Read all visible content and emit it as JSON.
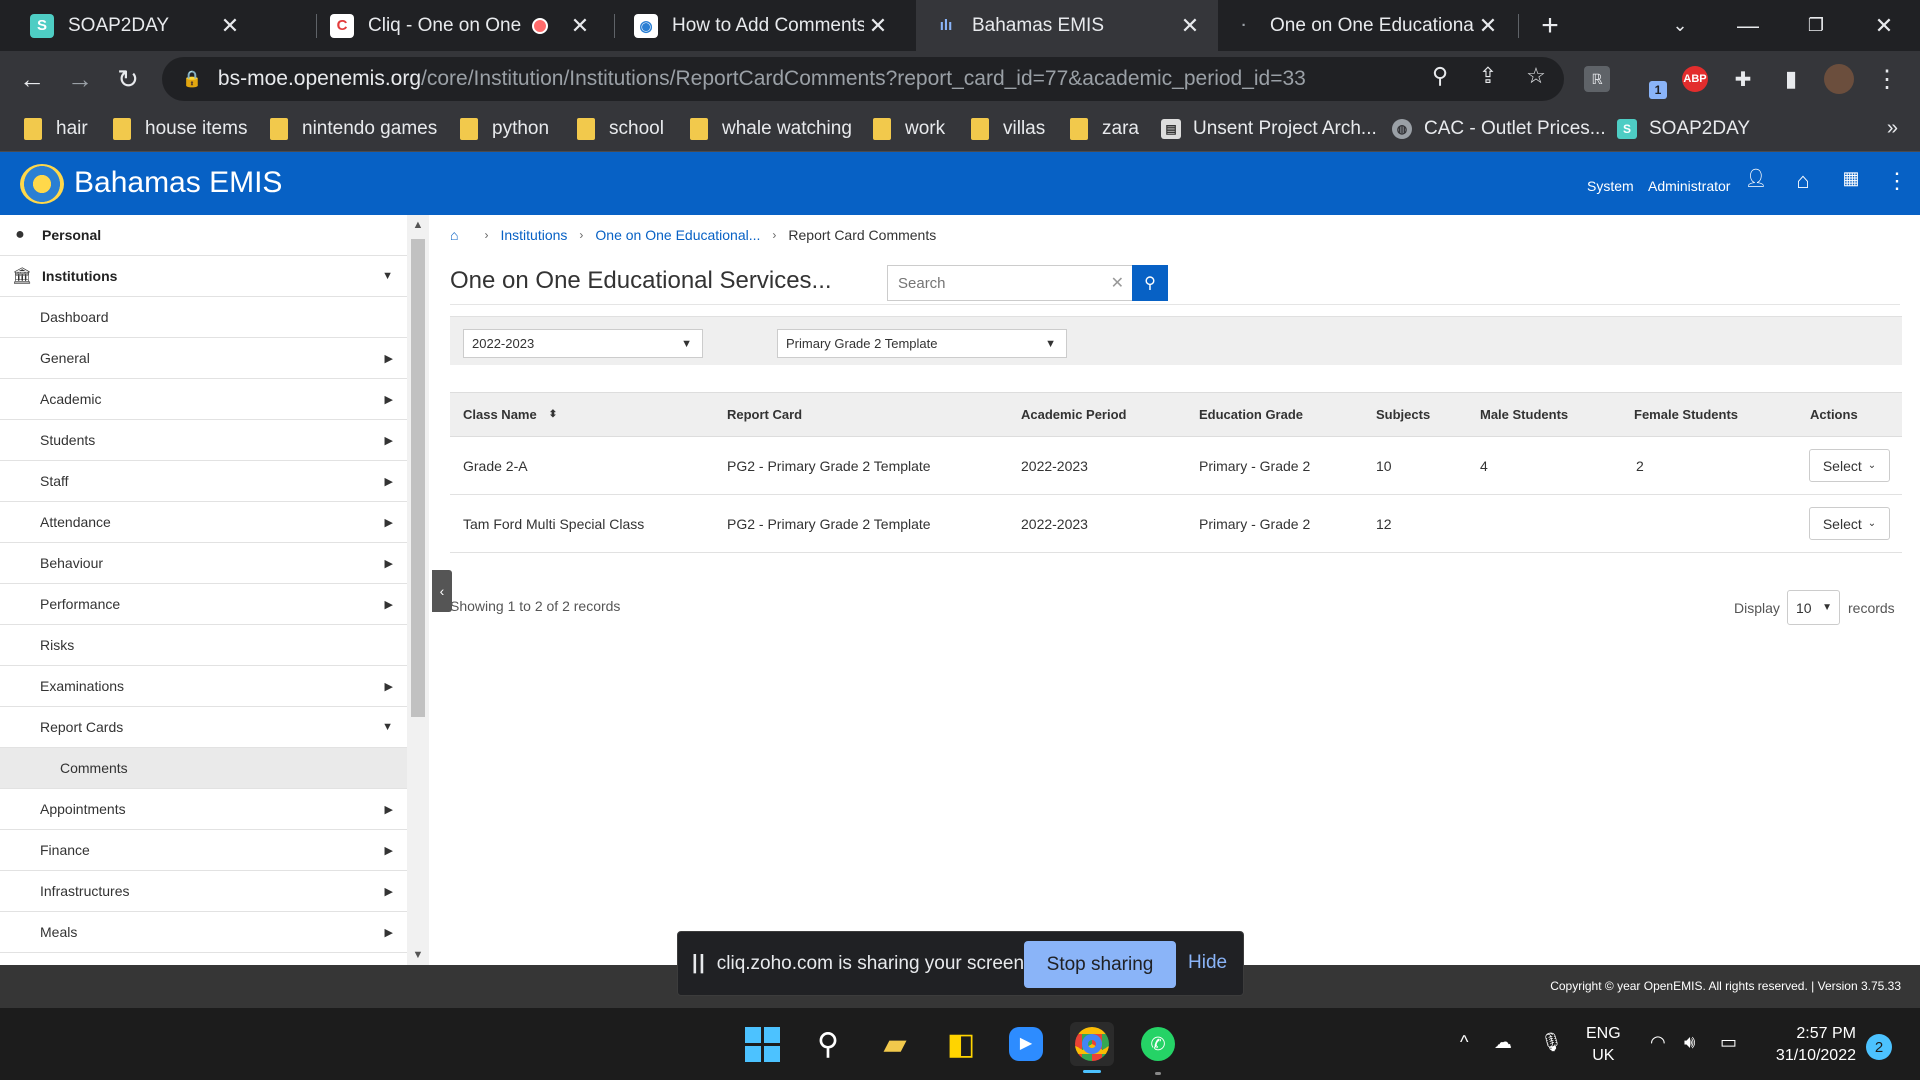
{
  "browser": {
    "tabs": [
      {
        "title": "SOAP2DAY",
        "icon": "soap2day-favicon",
        "color": "#4ecdc4",
        "glyph": "S"
      },
      {
        "title": "Cliq - One on One",
        "icon": "cliq-favicon",
        "color": "#ffffff",
        "glyph": "C"
      },
      {
        "title": "How to Add Comments T",
        "icon": "emis-favicon",
        "color": "#ffffff",
        "glyph": "◉"
      },
      {
        "title": "Bahamas EMIS",
        "icon": "emis-chart-favicon",
        "color": "#35363a",
        "glyph": "ılı"
      },
      {
        "title": "One on One Educational S",
        "icon": "loading-favicon",
        "color": "#202124",
        "glyph": "·"
      }
    ],
    "new_tab": "+",
    "url_host": "bs-moe.openemis.org",
    "url_path": "/core/Institution/Institutions/ReportCardComments?report_card_id=77&academic_period_id=33",
    "extension_badge": "ABP",
    "extension_count": "1",
    "bookmarks": [
      {
        "label": "hair",
        "type": "folder"
      },
      {
        "label": "house items",
        "type": "folder"
      },
      {
        "label": "nintendo games",
        "type": "folder"
      },
      {
        "label": "python",
        "type": "folder"
      },
      {
        "label": "school",
        "type": "folder"
      },
      {
        "label": "whale watching",
        "type": "folder"
      },
      {
        "label": "work",
        "type": "folder"
      },
      {
        "label": "villas",
        "type": "folder"
      },
      {
        "label": "zara",
        "type": "folder"
      },
      {
        "label": "Unsent Project Arch...",
        "type": "site"
      },
      {
        "label": "CAC - Outlet Prices...",
        "type": "site"
      },
      {
        "label": "SOAP2DAY",
        "type": "site"
      }
    ],
    "bookmarks_more": "»"
  },
  "app": {
    "title": "Bahamas EMIS",
    "user_label": "System",
    "user_name": "Administrator",
    "brand_color": "#0761c5"
  },
  "sidebar": {
    "items": [
      {
        "label": "Personal",
        "level": "top",
        "icon": "person-icon",
        "arrow": ""
      },
      {
        "label": "Institutions",
        "level": "top",
        "icon": "institution-icon",
        "arrow": "▼"
      },
      {
        "label": "Dashboard",
        "level": "item",
        "arrow": ""
      },
      {
        "label": "General",
        "level": "item",
        "arrow": "▶"
      },
      {
        "label": "Academic",
        "level": "item",
        "arrow": "▶"
      },
      {
        "label": "Students",
        "level": "item",
        "arrow": "▶"
      },
      {
        "label": "Staff",
        "level": "item",
        "arrow": "▶"
      },
      {
        "label": "Attendance",
        "level": "item",
        "arrow": "▶"
      },
      {
        "label": "Behaviour",
        "level": "item",
        "arrow": "▶"
      },
      {
        "label": "Performance",
        "level": "item",
        "arrow": "▶"
      },
      {
        "label": "Risks",
        "level": "item",
        "arrow": ""
      },
      {
        "label": "Examinations",
        "level": "item",
        "arrow": "▶"
      },
      {
        "label": "Report Cards",
        "level": "item",
        "arrow": "▼"
      },
      {
        "label": "Comments",
        "level": "sub",
        "arrow": ""
      },
      {
        "label": "Appointments",
        "level": "item",
        "arrow": "▶"
      },
      {
        "label": "Finance",
        "level": "item",
        "arrow": "▶"
      },
      {
        "label": "Infrastructures",
        "level": "item",
        "arrow": "▶"
      },
      {
        "label": "Meals",
        "level": "item",
        "arrow": "▶"
      }
    ]
  },
  "breadcrumb": {
    "items": [
      "Institutions",
      "One on One Educational...",
      "Report Card Comments"
    ]
  },
  "page": {
    "title": "One on One Educational Services...",
    "search_placeholder": "Search"
  },
  "filters": {
    "academic_period": "2022-2023",
    "template": "Primary Grade 2 Template"
  },
  "table": {
    "headers": [
      "Class Name",
      "Report Card",
      "Academic Period",
      "Education Grade",
      "Subjects",
      "Male Students",
      "Female Students",
      "Actions"
    ],
    "rows": [
      {
        "class_name": "Grade 2-A",
        "report_card": "PG2 - Primary Grade 2 Template",
        "academic_period": "2022-2023",
        "education_grade": "Primary - Grade 2",
        "subjects": "10",
        "male": "4",
        "female": "2",
        "action": "Select"
      },
      {
        "class_name": "Tam Ford Multi Special Class",
        "report_card": "PG2 - Primary Grade 2 Template",
        "academic_period": "2022-2023",
        "education_grade": "Primary - Grade 2",
        "subjects": "12",
        "male": "",
        "female": "",
        "action": "Select"
      }
    ]
  },
  "pagination": {
    "showing": "Showing 1 to 2 of 2 records",
    "display_label": "Display",
    "display_value": "10",
    "records_label": "records"
  },
  "footer": {
    "copyright": "Copyright © year OpenEMIS. All rights reserved. | Version 3.75.33"
  },
  "share_banner": {
    "message": "cliq.zoho.com is sharing your screen.",
    "stop": "Stop sharing",
    "hide": "Hide"
  },
  "taskbar": {
    "lang_top": "ENG",
    "lang_bottom": "UK",
    "time": "2:57 PM",
    "date": "31/10/2022",
    "notifications": "2"
  }
}
